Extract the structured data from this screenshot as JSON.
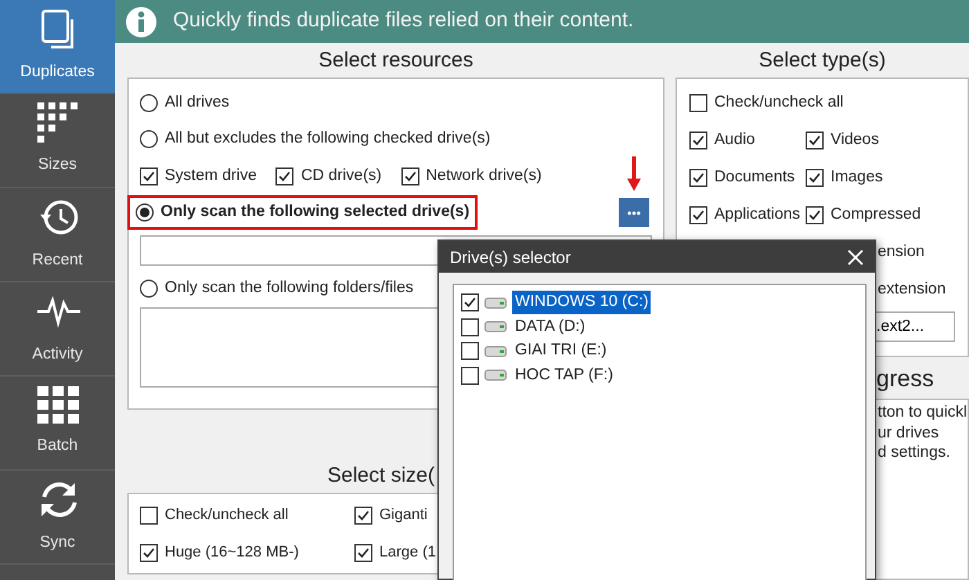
{
  "sidebar": {
    "items": [
      {
        "kind": "duplicates",
        "label": "Duplicates",
        "selected": true
      },
      {
        "kind": "sizes",
        "label": "Sizes",
        "selected": false
      },
      {
        "kind": "recent",
        "label": "Recent",
        "selected": false
      },
      {
        "kind": "activity",
        "label": "Activity",
        "selected": false
      },
      {
        "kind": "batch",
        "label": "Batch",
        "selected": false
      },
      {
        "kind": "sync",
        "label": "Sync",
        "selected": false
      }
    ]
  },
  "banner": {
    "text": "Quickly finds duplicate files relied on their content."
  },
  "resources": {
    "title": "Select resources",
    "rows": [
      {
        "kind": "radio",
        "label": "All drives",
        "selected": false,
        "highlighted": false
      },
      {
        "kind": "radio",
        "label": "All but excludes the following checked drive(s)",
        "selected": false,
        "highlighted": false
      },
      {
        "kind": "checks",
        "items": [
          {
            "label": "System drive",
            "checked": true
          },
          {
            "label": "CD drive(s)",
            "checked": true
          },
          {
            "label": "Network drive(s)",
            "checked": true
          }
        ]
      },
      {
        "kind": "radio",
        "label": "Only scan the following selected drive(s)",
        "selected": true,
        "highlighted": true
      },
      {
        "kind": "field"
      },
      {
        "kind": "radio",
        "label": "Only scan the following folders/files",
        "selected": false,
        "highlighted": false
      },
      {
        "kind": "area"
      }
    ]
  },
  "sizes": {
    "title": "Select size(",
    "items": [
      {
        "label": "Check/uncheck all",
        "checked": false
      },
      {
        "label": "Giganti",
        "checked": true
      },
      {
        "label": "Huge (16~128 MB-)",
        "checked": true
      },
      {
        "label": "Large (1",
        "checked": true
      }
    ]
  },
  "types": {
    "title": "Select type(s)",
    "check_all": {
      "label": "Check/uncheck all",
      "checked": false
    },
    "items": [
      {
        "label": "Audio",
        "checked": true
      },
      {
        "label": "Videos",
        "checked": true
      },
      {
        "label": "Documents",
        "checked": true
      },
      {
        "label": "Images",
        "checked": true
      },
      {
        "label": "Applications",
        "checked": true
      },
      {
        "label": "Compressed",
        "checked": true
      }
    ],
    "partial_rows": [
      "ension",
      "extension"
    ],
    "extension_field": {
      "value": ".ext2..."
    }
  },
  "progress": {
    "title": "gress",
    "lines": [
      "tton to quickl",
      "ur drives",
      "d settings."
    ]
  },
  "dialog": {
    "title": "Drive(s) selector",
    "drives": [
      {
        "label": "WINDOWS 10 (C:)",
        "checked": true,
        "selected": true
      },
      {
        "label": "DATA (D:)",
        "checked": false,
        "selected": false
      },
      {
        "label": "GIAI TRI (E:)",
        "checked": false,
        "selected": false
      },
      {
        "label": "HOC TAP (F:)",
        "checked": false,
        "selected": false
      }
    ]
  }
}
